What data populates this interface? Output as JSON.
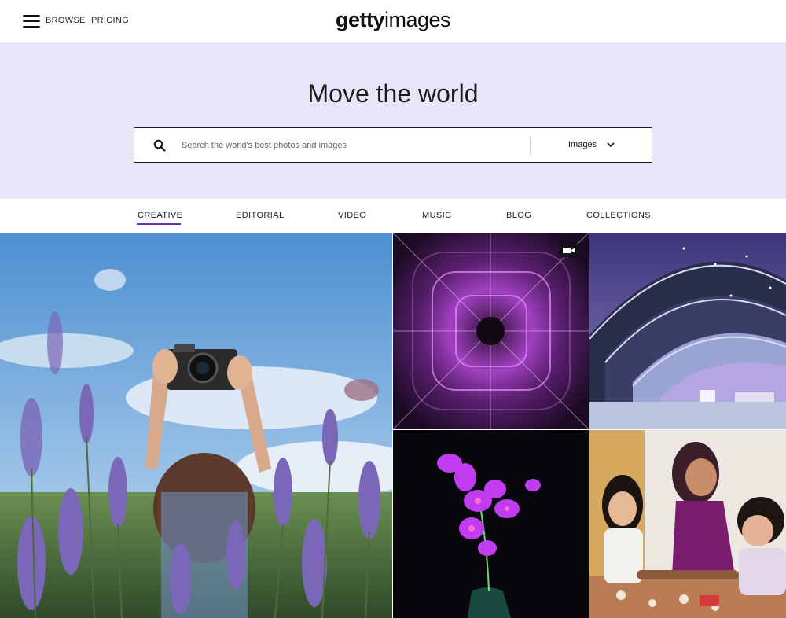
{
  "header": {
    "menu_icon": "hamburger-menu-icon",
    "browse_label": "BROWSE",
    "pricing_label": "PRICING",
    "logo_bold": "getty",
    "logo_light": "images"
  },
  "hero": {
    "title": "Move the world",
    "search": {
      "icon": "search-icon",
      "placeholder": "Search the world's best photos and images",
      "value": "",
      "type_selected": "Images",
      "type_icon": "chevron-down-icon"
    }
  },
  "tabs": [
    {
      "label": "CREATIVE",
      "active": true
    },
    {
      "label": "EDITORIAL",
      "active": false
    },
    {
      "label": "VIDEO",
      "active": false
    },
    {
      "label": "MUSIC",
      "active": false
    },
    {
      "label": "BLOG",
      "active": false
    },
    {
      "label": "COLLECTIONS",
      "active": false
    }
  ],
  "mosaic": {
    "tiles": [
      {
        "subject": "Woman photographing in lavender field"
      },
      {
        "subject": "Purple digital abstract tunnel",
        "badge": "video-camera-icon"
      },
      {
        "subject": "Curved modern architecture at dusk"
      },
      {
        "subject": "Glowing purple orchid in vase"
      },
      {
        "subject": "Family baking together"
      }
    ]
  },
  "colors": {
    "hero_bg": "#e6e6f8",
    "accent": "#6b2c9e",
    "text": "#111111"
  }
}
